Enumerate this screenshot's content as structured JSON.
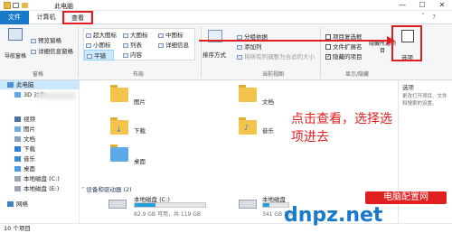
{
  "window": {
    "title": "此电脑",
    "controls": [
      "—",
      "☐",
      "✕"
    ]
  },
  "tabs": {
    "file": "文件",
    "computer": "计算机",
    "view": "查看"
  },
  "ribbon": {
    "pane_group": {
      "nav_pane": "导航窗格",
      "preview_pane": "预览窗格",
      "details_pane": "详细信息窗格",
      "label": "窗格"
    },
    "layout_group": {
      "items": [
        "超大图标",
        "大图标",
        "中图标",
        "小图标",
        "列表",
        "详细信息",
        "平铺",
        "内容"
      ],
      "label": "布局"
    },
    "sort": "排序方式",
    "current_view": {
      "group_by": "分组依据",
      "add_columns": "添加列",
      "fit_columns": "将所有列调整为合适的大小",
      "label": "当前视图"
    },
    "show_hide": {
      "item_checkbox": "项目复选框",
      "file_ext": "文件扩展名",
      "hidden_items": "隐藏的项目",
      "hide_selected": "隐藏所选项目",
      "label": "显示/隐藏"
    },
    "options": "选项"
  },
  "sidebar": {
    "items": [
      "此电脑",
      "3D 对象",
      "视频",
      "图片",
      "文档",
      "下载",
      "音乐",
      "桌面",
      "本地磁盘 (C:)",
      "本地磁盘 (E:)",
      "网络"
    ]
  },
  "main": {
    "folders": [
      "图片",
      "文档",
      "下载",
      "音乐",
      "桌面"
    ],
    "devices_header": "设备和驱动器 (2)",
    "drives": [
      {
        "name": "本地磁盘 (C:)",
        "info": "82.9 GB 可用，共 119 GB",
        "used_fraction": 0.3
      },
      {
        "name": "本地磁盘",
        "info": "341 GB 可用",
        "used_fraction": 0.25
      }
    ]
  },
  "preview": {
    "title": "选项",
    "desc": "更改打开项目、文件和搜索的设置。"
  },
  "statusbar": {
    "count": "10 个项目"
  },
  "annotation": {
    "text": "点击查看，选择选项进去"
  },
  "watermark": {
    "line1": "电脑配置网",
    "line2": "dnpz.net"
  },
  "colors": {
    "accent": "#1979ca",
    "highlight": "#e02020",
    "selection": "#cce8ff"
  }
}
